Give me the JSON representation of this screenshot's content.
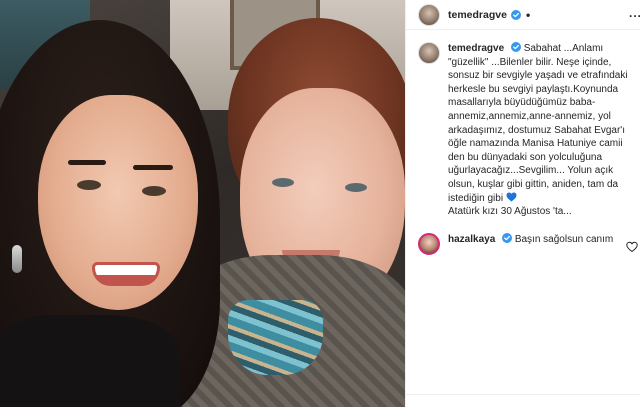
{
  "post": {
    "author": "temedragve",
    "header_separator": "•",
    "more_label": "..."
  },
  "caption": {
    "username": "temedragve",
    "text": "Sabahat ...Anlamı \"güzellik\" ...Bilenler bilir. Neşe içinde, sonsuz bir sevgiyle yaşadı ve etrafındaki herkesle bu sevgiyi paylaştı.Koynunda masallarıyla büyüdüğümüz baba-annemiz,annemiz,anne-annemiz, yol arkadaşımız, dostumuz Sabahat Evgar'ı öğle namazında Manisa Hatuniye camii den bu dünyadaki son yolculuğuna uğurlayacağız...Sevgilim... Yolun açık olsun, kuşlar gibi gittin, aniden, tam da istediğin gibi",
    "text_tail": "Atatürk kızı 30 Ağustos 'ta..."
  },
  "comment": {
    "username": "hazalkaya",
    "text": "Başın sağolsun canım"
  },
  "colors": {
    "verified_blue": "#3897f0",
    "heart_blue": "#1f75d6",
    "text": "#262626"
  },
  "icons": {
    "verified": "verified-badge-icon",
    "heart": "heart-outline-icon",
    "blue_heart": "blue-heart-emoji-icon"
  }
}
